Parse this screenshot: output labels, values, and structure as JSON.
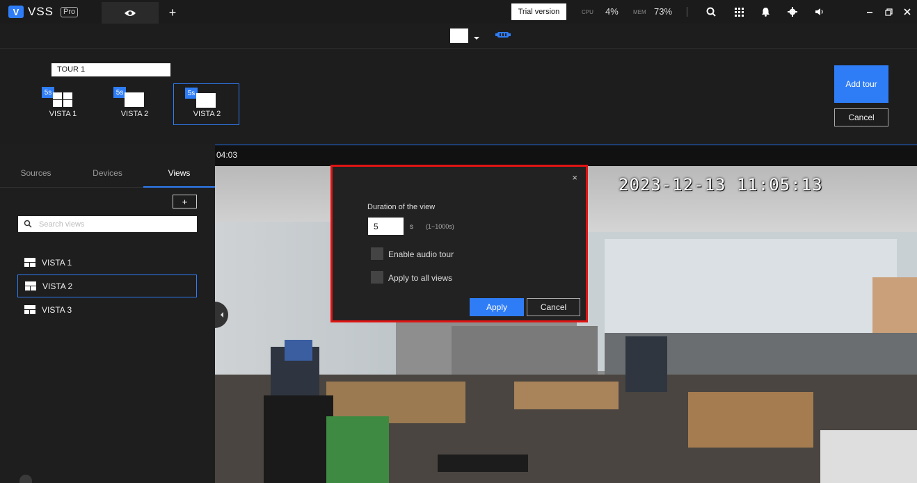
{
  "app": {
    "logo": "V",
    "name": "VSS",
    "edition": "Pro"
  },
  "topbar": {
    "trial": "Trial version",
    "cpu_label": "CPU",
    "cpu_value": "4%",
    "mem_label": "MEM",
    "mem_value": "73%",
    "add_tab": "+",
    "icons": [
      "eye-icon",
      "search-icon",
      "grid-icon",
      "bell-icon",
      "gear-icon",
      "volume-icon",
      "minimize-icon",
      "restore-icon",
      "close-icon"
    ]
  },
  "tour": {
    "name": "TOUR 1",
    "items": [
      {
        "badge": "5s",
        "label": "VISTA 1",
        "selected": false
      },
      {
        "badge": "5s",
        "label": "VISTA 2",
        "selected": false
      },
      {
        "badge": "5s",
        "label": "VISTA 2",
        "selected": true
      }
    ],
    "add_button": "Add tour",
    "cancel_button": "Cancel"
  },
  "sidebar": {
    "tabs": [
      {
        "label": "Sources",
        "active": false
      },
      {
        "label": "Devices",
        "active": false
      },
      {
        "label": "Views",
        "active": true
      }
    ],
    "add_button": "+",
    "search_placeholder": "Search views",
    "views": [
      {
        "label": "VISTA 1",
        "selected": false
      },
      {
        "label": "VISTA 2",
        "selected": true
      },
      {
        "label": "VISTA 3",
        "selected": false
      }
    ]
  },
  "viewer": {
    "time": "04:03",
    "osd_timestamp": "2023-12-13 11:05:13"
  },
  "modal": {
    "close": "×",
    "duration_label": "Duration of the view",
    "duration_value": "5",
    "duration_unit": "s",
    "duration_range": "(1~1000s)",
    "options": [
      {
        "label": "Enable audio tour",
        "checked": false
      },
      {
        "label": "Apply to all views",
        "checked": false
      }
    ],
    "apply": "Apply",
    "cancel": "Cancel"
  },
  "colors": {
    "accent": "#2f7df6",
    "highlight": "#e01414",
    "background": "#141414"
  }
}
